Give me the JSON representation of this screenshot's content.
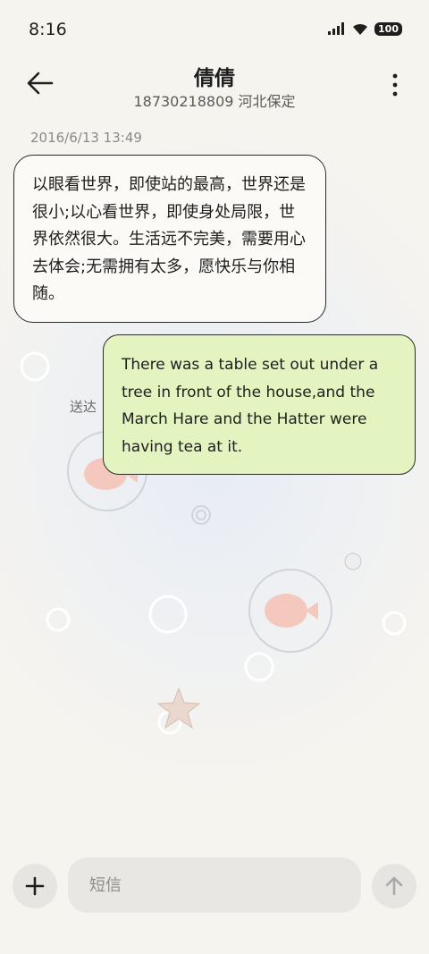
{
  "status_bar": {
    "time": "8:16",
    "battery": "100"
  },
  "header": {
    "contact_name": "倩倩",
    "contact_detail": "18730218809 河北保定"
  },
  "conversation": {
    "timestamp": "2016/6/13 13:49",
    "messages": [
      {
        "direction": "incoming",
        "text": "以眼看世界，即使站的最高，世界还是很小;以心看世界，即使身处局限，世界依然很大。生活远不完美，需要用心去体会;无需拥有太多，愿快乐与你相随。"
      },
      {
        "direction": "outgoing",
        "text": "There was a table set out under a tree in front of the house,and the March Hare and the Hatter were having tea at it."
      }
    ],
    "delivery_status": "送达"
  },
  "composer": {
    "placeholder": "短信"
  },
  "icons": {
    "back": "arrow-left-icon",
    "more": "more-vertical-icon",
    "add": "plus-icon",
    "send": "arrow-up-icon",
    "signal": "signal-icon",
    "wifi": "wifi-icon",
    "battery": "battery-icon"
  },
  "colors": {
    "outgoing_bubble": "#e3f4c0",
    "incoming_bubble": "#fbfaf6",
    "background": "#f6f4ef"
  }
}
